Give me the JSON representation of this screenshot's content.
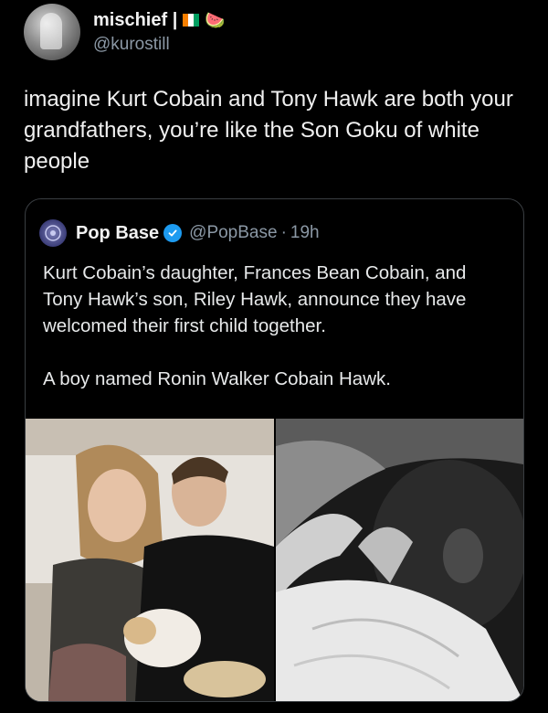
{
  "post": {
    "display_name": "mischief |",
    "handle": "@kurostill",
    "text": "imagine Kurt Cobain and Tony Hawk are both your grandfathers, you’re like the Son Goku of white people",
    "flag_colors": [
      "#f77f00",
      "#ffffff",
      "#009e60"
    ],
    "emoji": "🍉"
  },
  "quote": {
    "display_name": "Pop Base",
    "handle": "@PopBase",
    "separator": "·",
    "time": "19h",
    "verified_color": "#1d9bf0",
    "paragraph1": "Kurt Cobain’s daughter, Frances Bean Cobain, and Tony Hawk’s son, Riley Hawk, announce they have welcomed their first child together.",
    "paragraph2": "A boy named Ronin Walker Cobain Hawk."
  }
}
